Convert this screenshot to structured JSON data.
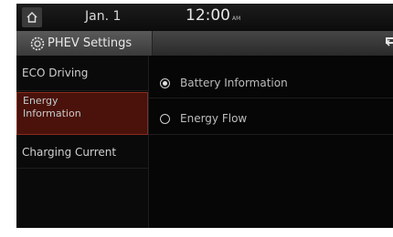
{
  "status": {
    "date": "Jan. 1",
    "time": "12:00",
    "ampm": "AM"
  },
  "header": {
    "title": "PHEV Settings"
  },
  "sidebar": {
    "items": [
      {
        "label": "ECO Driving",
        "active": false
      },
      {
        "label": "Energy Information",
        "active": true
      },
      {
        "label": "Charging Current",
        "active": false
      }
    ]
  },
  "content": {
    "options": [
      {
        "label": "Battery Information",
        "selected": true
      },
      {
        "label": "Energy Flow",
        "selected": false
      }
    ]
  },
  "colors": {
    "active_bg": "#4a120b",
    "active_border": "#8a2a1e"
  }
}
